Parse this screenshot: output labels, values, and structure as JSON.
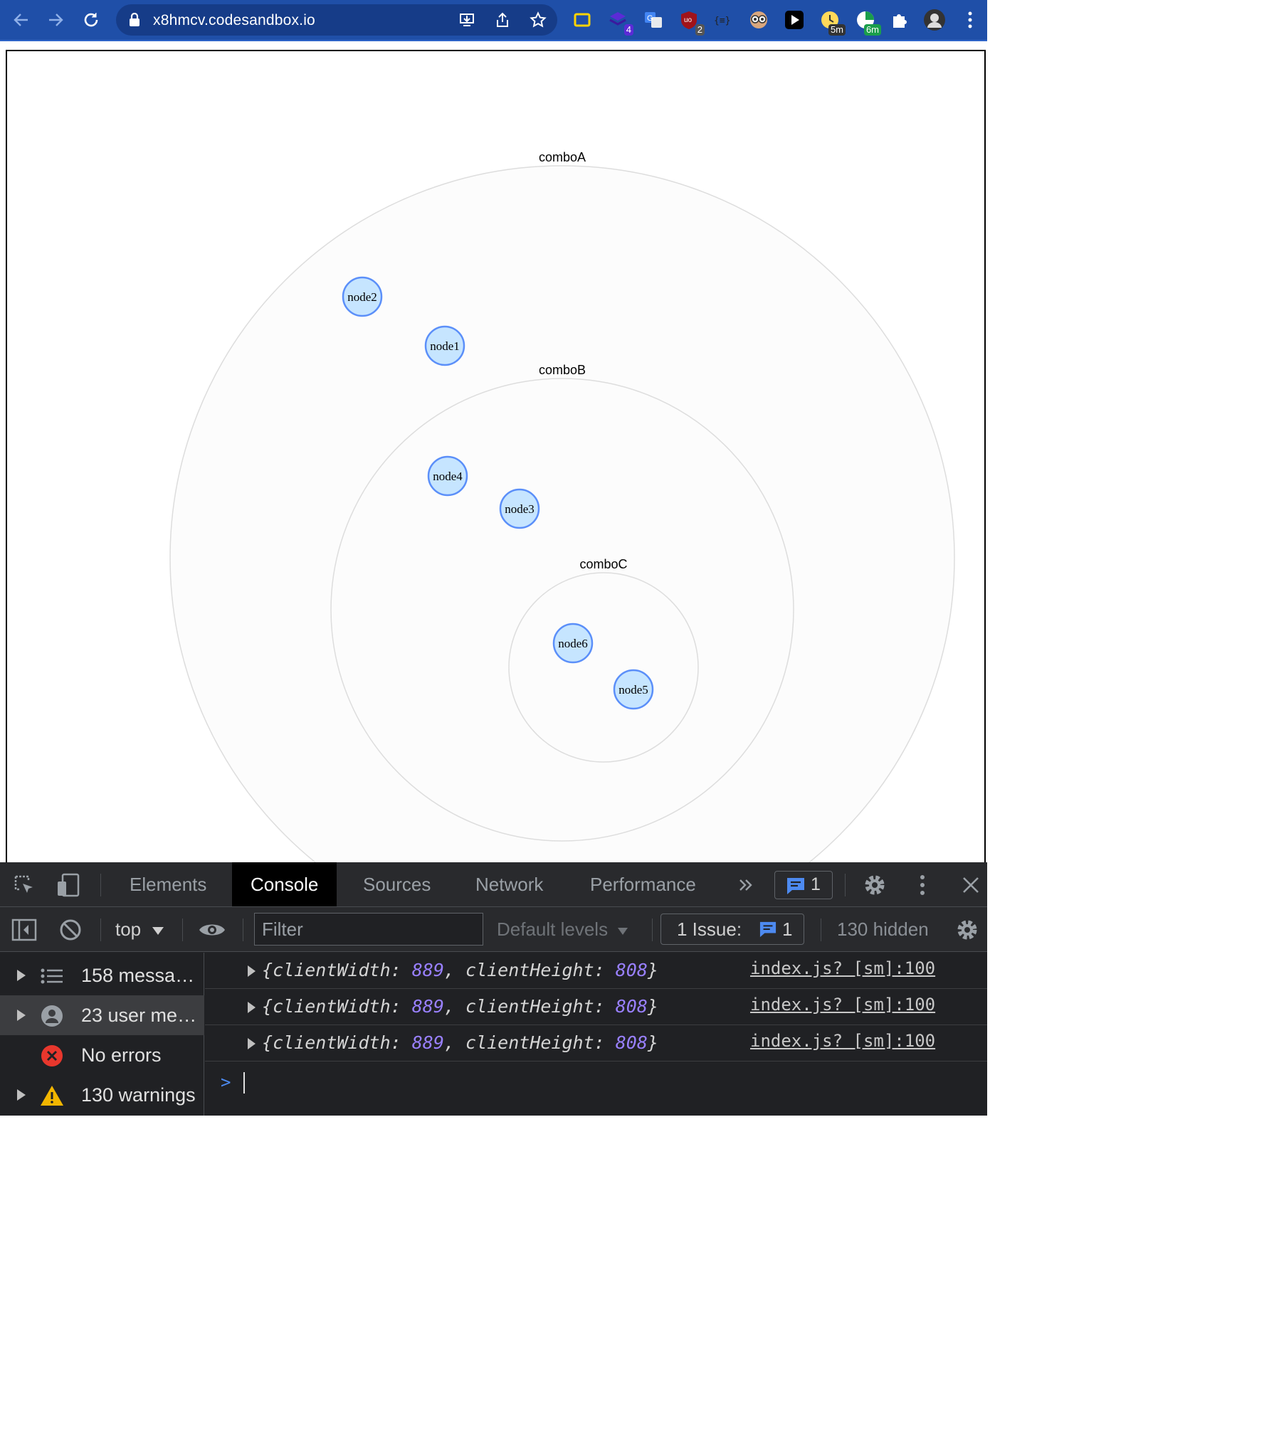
{
  "browser": {
    "url": "x8hmcv.codesandbox.io",
    "extensions": [
      {
        "name": "sync-ext-icon",
        "badge": ""
      },
      {
        "name": "stack-ext-icon",
        "badge": "4"
      },
      {
        "name": "translate-ext-icon",
        "badge": ""
      },
      {
        "name": "ublock-ext-icon",
        "badge": "2"
      },
      {
        "name": "json-ext-icon",
        "badge": ""
      },
      {
        "name": "owl-ext-icon",
        "badge": ""
      },
      {
        "name": "play-ext-icon",
        "badge": ""
      },
      {
        "name": "timer-ext-icon",
        "badge": "5m"
      },
      {
        "name": "clock-ext-icon",
        "badge": "6m"
      }
    ],
    "colors": {
      "toolbar": "#1f4fa8",
      "omnibox": "#163c88"
    }
  },
  "graph": {
    "combos": [
      {
        "id": "comboA",
        "label": "comboA"
      },
      {
        "id": "comboB",
        "label": "comboB"
      },
      {
        "id": "comboC",
        "label": "comboC"
      }
    ],
    "nodes": [
      {
        "id": "node1",
        "label": "node1"
      },
      {
        "id": "node2",
        "label": "node2"
      },
      {
        "id": "node3",
        "label": "node3"
      },
      {
        "id": "node4",
        "label": "node4"
      },
      {
        "id": "node5",
        "label": "node5"
      },
      {
        "id": "node6",
        "label": "node6"
      }
    ],
    "colors": {
      "node_fill": "#c6e5ff",
      "node_stroke": "#5b8ff9",
      "combo_fill": "#fcfcfc",
      "combo_stroke": "#dddddd"
    }
  },
  "devtools": {
    "tabs": [
      "Elements",
      "Console",
      "Sources",
      "Network",
      "Performance"
    ],
    "active_tab": "Console",
    "issues_badge": "1",
    "context": "top",
    "filter_placeholder": "Filter",
    "levels": "Default levels",
    "issue_label": "1 Issue:",
    "issue_count": "1",
    "hidden": "130 hidden",
    "sidebar": [
      {
        "label": "158 messa…",
        "icon": "list-icon"
      },
      {
        "label": "23 user me…",
        "icon": "user-icon"
      },
      {
        "label": "No errors",
        "icon": "error-icon"
      },
      {
        "label": "130 warnings",
        "icon": "warning-icon"
      }
    ],
    "logs": [
      {
        "k1": "clientWidth",
        "v1": "889",
        "k2": "clientHeight",
        "v2": "808",
        "source": "index.js? [sm]:100"
      },
      {
        "k1": "clientWidth",
        "v1": "889",
        "k2": "clientHeight",
        "v2": "808",
        "source": "index.js? [sm]:100"
      },
      {
        "k1": "clientWidth",
        "v1": "889",
        "k2": "clientHeight",
        "v2": "808",
        "source": "index.js? [sm]:100"
      }
    ]
  }
}
